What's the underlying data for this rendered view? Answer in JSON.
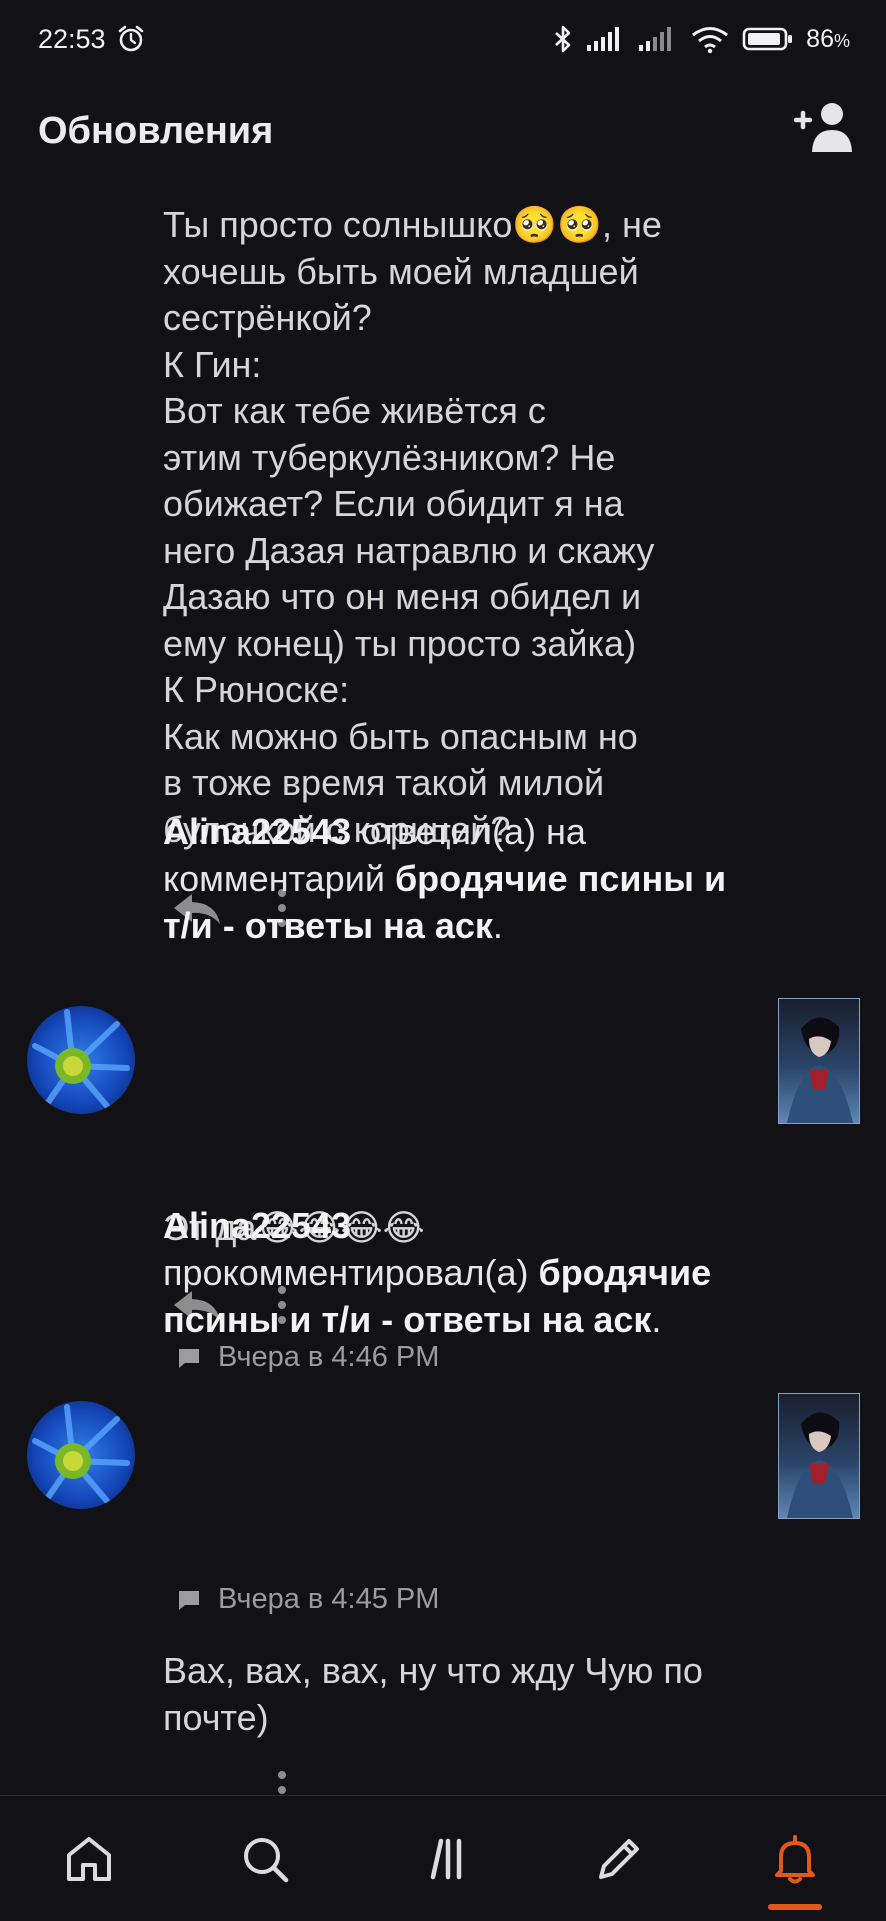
{
  "status_bar": {
    "time": "22:53",
    "battery_percent": "86",
    "battery_unit": "%",
    "icons": [
      "alarm-icon",
      "bluetooth-icon",
      "signal-icon",
      "signal-icon-2",
      "wifi-icon",
      "battery-icon"
    ]
  },
  "header": {
    "title": "Обновления",
    "add_user_icon": "add-user-icon"
  },
  "feed": {
    "top_comment": {
      "text": "Ты просто солнышко🥺🥺, не\nхочешь быть моей младшей\nсестрёнкой?\nК Гин:\nВот как тебе живётся с\nэтим туберкулёзником? Не\nобижает? Если обидит я на\nнего Дазая натравлю и скажу\nДазаю что он меня обидел и\nему конец) ты просто зайка)\nК Рюноске:\nКак можно быть опасным но\nв тоже время такой милой\nбулочкой с корицей?"
    },
    "notifications": [
      {
        "user": "Alina22543",
        "action": " ответил(а) на комментарий ",
        "target": "бродячие псины и т/и - ответы на аск",
        "suffix": ".",
        "time": "Вчера в 4:46 PM",
        "comment": "Эт да😂😂😂😂"
      },
      {
        "user": "Alina22543",
        "action": " прокомментировал(а) ",
        "target": "бродячие псины и т/и - ответы на аск",
        "suffix": ".",
        "time": "Вчера в 4:45 PM",
        "comment": "Вах, вах, вах, ну что жду Чую по почте)"
      }
    ]
  },
  "bottom_nav": {
    "items": [
      "home-icon",
      "search-icon",
      "library-icon",
      "write-icon",
      "notifications-icon"
    ],
    "active": "notifications-icon",
    "accent_color": "#e05a1a"
  }
}
